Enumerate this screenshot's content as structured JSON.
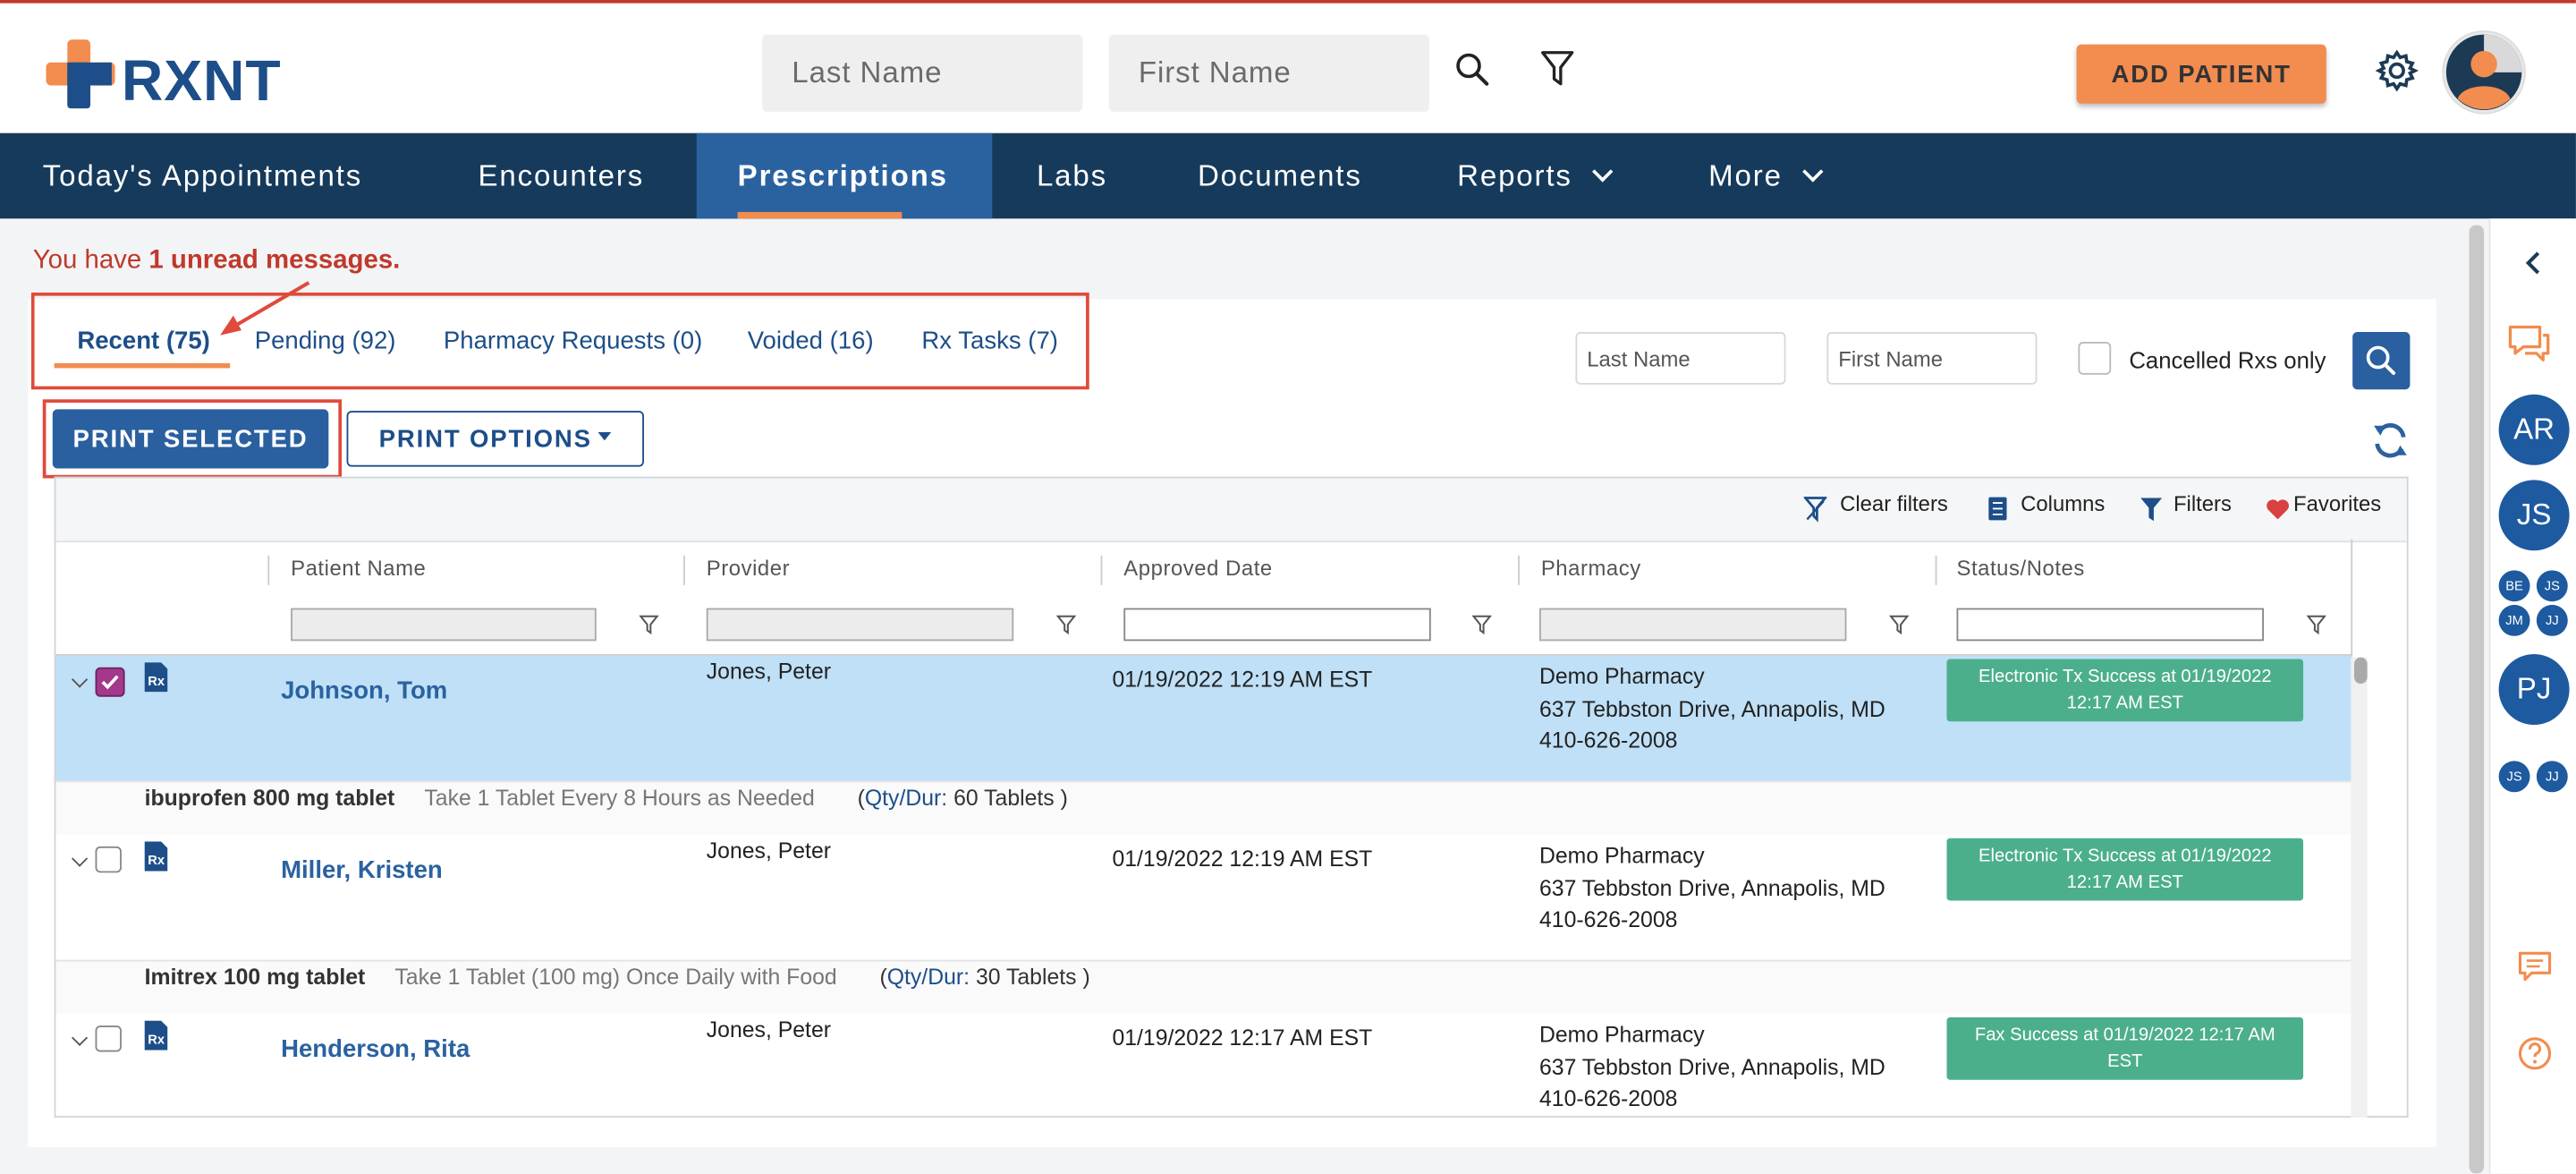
{
  "header": {
    "logo_text": "RXNT",
    "last_name_placeholder": "Last Name",
    "first_name_placeholder": "First Name",
    "add_patient_label": "ADD PATIENT"
  },
  "nav": {
    "items": [
      {
        "label": "Today's Appointments"
      },
      {
        "label": "Encounters"
      },
      {
        "label": "Prescriptions"
      },
      {
        "label": "Labs"
      },
      {
        "label": "Documents"
      },
      {
        "label": "Reports"
      },
      {
        "label": "More"
      }
    ]
  },
  "message": {
    "prefix": "You have ",
    "count_text": "1 unread messages."
  },
  "tabs": [
    {
      "label": "Recent (75)"
    },
    {
      "label": "Pending (92)"
    },
    {
      "label": "Pharmacy Requests (0)"
    },
    {
      "label": "Voided (16)"
    },
    {
      "label": "Rx Tasks (7)"
    }
  ],
  "search": {
    "last_name_placeholder": "Last Name",
    "first_name_placeholder": "First Name",
    "cancelled_label": "Cancelled Rxs only"
  },
  "actions": {
    "print_selected": "PRINT SELECTED",
    "print_options": "PRINT OPTIONS"
  },
  "toolbar": {
    "clear_filters": "Clear filters",
    "columns": "Columns",
    "filters": "Filters",
    "favorites": "Favorites"
  },
  "columns": [
    "Patient Name",
    "Provider",
    "Approved Date",
    "Pharmacy",
    "Status/Notes"
  ],
  "rows": [
    {
      "patient": "Johnson, Tom",
      "provider": "Jones, Peter",
      "approved": "01/19/2022 12:19 AM EST",
      "pharmacy_name": "Demo Pharmacy",
      "pharmacy_addr": "637 Tebbston Drive, Annapolis, MD",
      "pharmacy_phone": "410-626-2008",
      "status_line1": "Electronic Tx Success at 01/19/2022",
      "status_line2": "12:17 AM EST",
      "checked": true,
      "drug": "ibuprofen 800 mg tablet",
      "sig": "Take 1 Tablet Every 8 Hours as Needed",
      "qty_label": "Qty/Dur:",
      "qty": "60 Tablets )"
    },
    {
      "patient": "Miller, Kristen",
      "provider": "Jones, Peter",
      "approved": "01/19/2022 12:19 AM EST",
      "pharmacy_name": "Demo Pharmacy",
      "pharmacy_addr": "637 Tebbston Drive, Annapolis, MD",
      "pharmacy_phone": "410-626-2008",
      "status_line1": "Electronic Tx Success at 01/19/2022",
      "status_line2": "12:17 AM EST",
      "checked": false,
      "drug": "Imitrex 100 mg tablet",
      "sig": "Take 1 Tablet (100 mg) Once Daily with Food",
      "qty_label": "Qty/Dur:",
      "qty": "30 Tablets )"
    },
    {
      "patient": "Henderson, Rita",
      "provider": "Jones, Peter",
      "approved": "01/19/2022 12:17 AM EST",
      "pharmacy_name": "Demo Pharmacy",
      "pharmacy_addr": "637 Tebbston Drive, Annapolis, MD",
      "pharmacy_phone": "410-626-2008",
      "status_line1": "Fax Success at 01/19/2022 12:17 AM",
      "status_line2": "EST",
      "checked": false
    }
  ],
  "sidebar": {
    "avatars": [
      "AR",
      "JS",
      "BE",
      "JS",
      "JM",
      "JJ",
      "PJ",
      "JS",
      "JJ"
    ]
  },
  "colors": {
    "brand_navy": "#153a5b",
    "brand_blue": "#1d4e89",
    "accent_orange": "#f28c4f",
    "selected_row": "#bfe0f7",
    "status_green": "#4caf8c",
    "annotation_red": "#e04a3b"
  }
}
